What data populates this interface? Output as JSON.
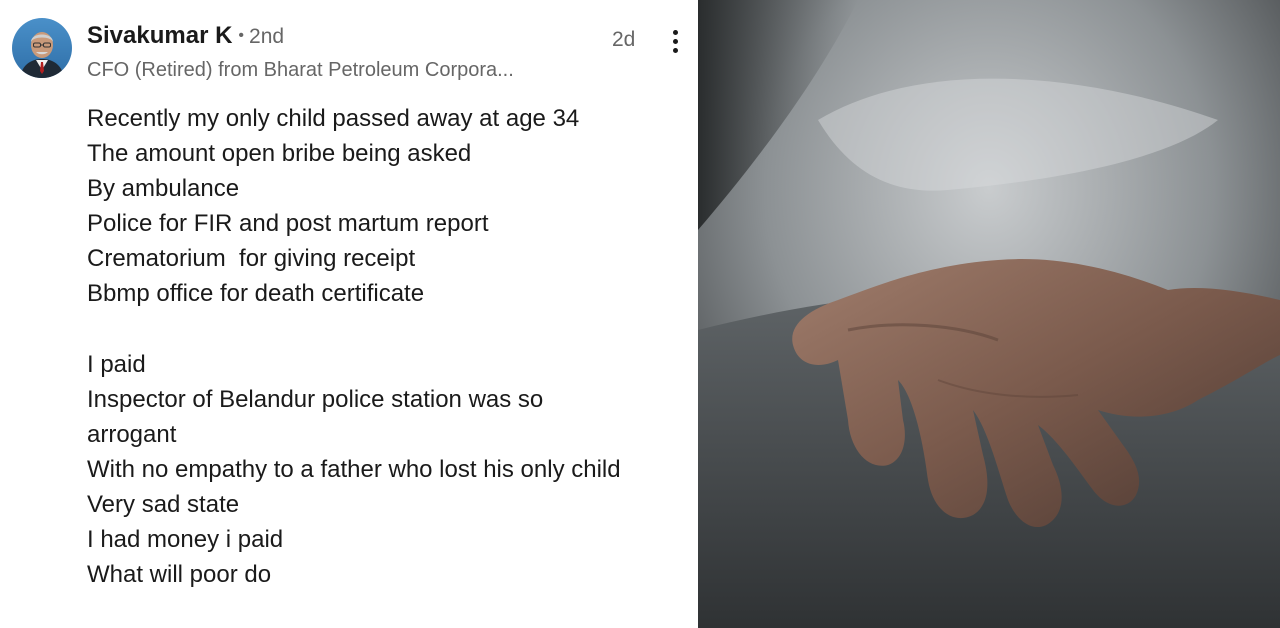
{
  "post": {
    "author": {
      "name": "Sivakumar K",
      "degree_separator": "•",
      "degree": "2nd",
      "headline": "CFO (Retired) from Bharat Petroleum Corpora...",
      "avatar_icon": "person-avatar"
    },
    "time_ago": "2d",
    "more_icon": "vertical-ellipsis-icon",
    "lines": [
      "Recently my only child passed away at age 34",
      "The amount open bribe being asked",
      "By ambulance",
      "Police for FIR and post martum report",
      "Crematorium  for giving receipt",
      "Bbmp office for death certificate",
      "",
      "I paid",
      "Inspector of Belandur police station was so",
      "arrogant",
      "With no empathy to a father who lost his only child",
      "Very sad state",
      "I had money i paid",
      "What will poor do"
    ]
  },
  "photo": {
    "subject": "outstretched-hand-under-sheet-photo"
  },
  "colors": {
    "text_primary": "#1a1a1a",
    "text_secondary": "#666666",
    "background": "#ffffff"
  }
}
